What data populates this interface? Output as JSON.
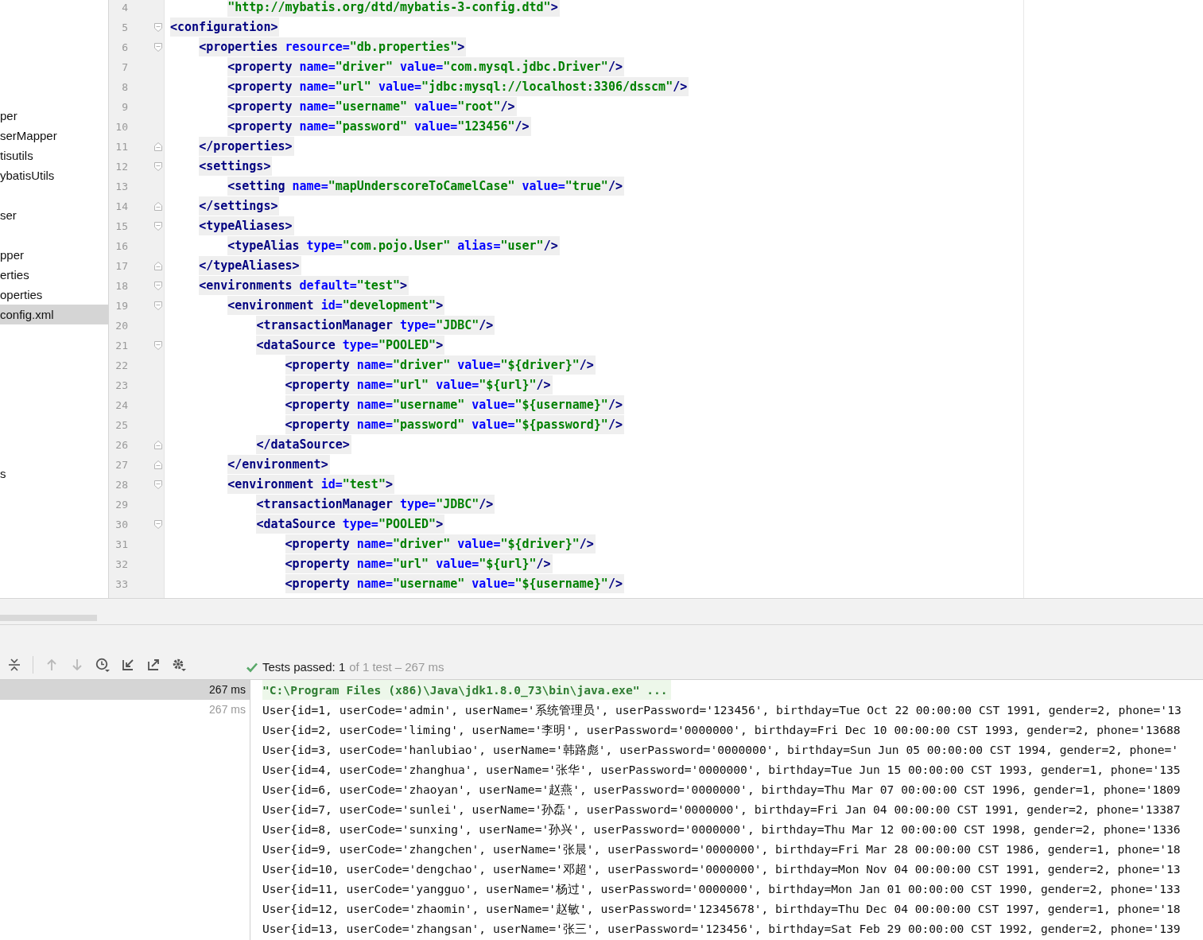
{
  "project_tree": {
    "items": [
      {
        "label": "per",
        "selected": false
      },
      {
        "label": "serMapper",
        "selected": false
      },
      {
        "label": "tisutils",
        "selected": false
      },
      {
        "label": "ybatisUtils",
        "selected": false
      },
      {
        "label": "ser",
        "selected": false
      },
      {
        "label": "pper",
        "selected": false
      },
      {
        "label": "erties",
        "selected": false
      },
      {
        "label": "operties",
        "selected": false
      },
      {
        "label": "config.xml",
        "selected": true
      },
      {
        "label": "s",
        "selected": false
      }
    ]
  },
  "editor": {
    "lines": [
      {
        "number": "4",
        "tokens": [
          {
            "kind": "value",
            "text": "        \"http://mybatis.org/dtd/mybatis-3-config.dtd\""
          },
          {
            "kind": "tag",
            "text": ">"
          }
        ]
      },
      {
        "number": "5",
        "kind": "open",
        "tokens": [
          {
            "kind": "tag",
            "text": "<configuration>"
          }
        ]
      },
      {
        "number": "6",
        "kind": "open",
        "tokens": [
          {
            "kind": "tag",
            "text": "    <properties"
          },
          {
            "kind": "attr",
            "text": " resource="
          },
          {
            "kind": "value",
            "text": "\"db.properties\""
          },
          {
            "kind": "tag",
            "text": ">"
          }
        ]
      },
      {
        "number": "7",
        "tokens": [
          {
            "kind": "tag",
            "text": "        <property"
          },
          {
            "kind": "attr",
            "text": " name="
          },
          {
            "kind": "value",
            "text": "\"driver\""
          },
          {
            "kind": "attr",
            "text": " value="
          },
          {
            "kind": "value",
            "text": "\"com.mysql.jdbc.Driver\""
          },
          {
            "kind": "tag",
            "text": "/>"
          }
        ]
      },
      {
        "number": "8",
        "tokens": [
          {
            "kind": "tag",
            "text": "        <property"
          },
          {
            "kind": "attr",
            "text": " name="
          },
          {
            "kind": "value",
            "text": "\"url\""
          },
          {
            "kind": "attr",
            "text": " value="
          },
          {
            "kind": "value",
            "text": "\"jdbc:mysql://localhost:3306/dsscm\""
          },
          {
            "kind": "tag",
            "text": "/>"
          }
        ]
      },
      {
        "number": "9",
        "tokens": [
          {
            "kind": "tag",
            "text": "        <property"
          },
          {
            "kind": "attr",
            "text": " name="
          },
          {
            "kind": "value",
            "text": "\"username\""
          },
          {
            "kind": "attr",
            "text": " value="
          },
          {
            "kind": "value",
            "text": "\"root\""
          },
          {
            "kind": "tag",
            "text": "/>"
          }
        ]
      },
      {
        "number": "10",
        "tokens": [
          {
            "kind": "tag",
            "text": "        <property"
          },
          {
            "kind": "attr",
            "text": " name="
          },
          {
            "kind": "value",
            "text": "\"password\""
          },
          {
            "kind": "attr",
            "text": " value="
          },
          {
            "kind": "value",
            "text": "\"123456\""
          },
          {
            "kind": "tag",
            "text": "/>"
          }
        ]
      },
      {
        "number": "11",
        "kind": "close",
        "tokens": [
          {
            "kind": "tag",
            "text": "    </properties>"
          }
        ]
      },
      {
        "number": "12",
        "kind": "open",
        "tokens": [
          {
            "kind": "tag",
            "text": "    <settings>"
          }
        ]
      },
      {
        "number": "13",
        "tokens": [
          {
            "kind": "tag",
            "text": "        <setting"
          },
          {
            "kind": "attr",
            "text": " name="
          },
          {
            "kind": "value",
            "text": "\"mapUnderscoreToCamelCase\""
          },
          {
            "kind": "attr",
            "text": " value="
          },
          {
            "kind": "value",
            "text": "\"true\""
          },
          {
            "kind": "tag",
            "text": "/>"
          }
        ]
      },
      {
        "number": "14",
        "kind": "close",
        "tokens": [
          {
            "kind": "tag",
            "text": "    </settings>"
          }
        ]
      },
      {
        "number": "15",
        "kind": "open",
        "tokens": [
          {
            "kind": "tag",
            "text": "    <typeAliases>"
          }
        ]
      },
      {
        "number": "16",
        "tokens": [
          {
            "kind": "tag",
            "text": "        <typeAlias"
          },
          {
            "kind": "attr",
            "text": " type="
          },
          {
            "kind": "value",
            "text": "\"com.pojo.User\""
          },
          {
            "kind": "attr",
            "text": " alias="
          },
          {
            "kind": "value",
            "text": "\"user\""
          },
          {
            "kind": "tag",
            "text": "/>"
          }
        ]
      },
      {
        "number": "17",
        "kind": "close",
        "tokens": [
          {
            "kind": "tag",
            "text": "    </typeAliases>"
          }
        ]
      },
      {
        "number": "18",
        "kind": "open",
        "tokens": [
          {
            "kind": "tag",
            "text": "    <environments"
          },
          {
            "kind": "attr",
            "text": " default="
          },
          {
            "kind": "value",
            "text": "\"test\""
          },
          {
            "kind": "tag",
            "text": ">"
          }
        ]
      },
      {
        "number": "19",
        "kind": "open",
        "tokens": [
          {
            "kind": "tag",
            "text": "        <environment"
          },
          {
            "kind": "attr",
            "text": " id="
          },
          {
            "kind": "value",
            "text": "\"development\""
          },
          {
            "kind": "tag",
            "text": ">"
          }
        ]
      },
      {
        "number": "20",
        "tokens": [
          {
            "kind": "tag",
            "text": "            <transactionManager"
          },
          {
            "kind": "attr",
            "text": " type="
          },
          {
            "kind": "value",
            "text": "\"JDBC\""
          },
          {
            "kind": "tag",
            "text": "/>"
          }
        ]
      },
      {
        "number": "21",
        "kind": "open",
        "tokens": [
          {
            "kind": "tag",
            "text": "            <dataSource"
          },
          {
            "kind": "attr",
            "text": " type="
          },
          {
            "kind": "value",
            "text": "\"POOLED\""
          },
          {
            "kind": "tag",
            "text": ">"
          }
        ]
      },
      {
        "number": "22",
        "tokens": [
          {
            "kind": "tag",
            "text": "                <property"
          },
          {
            "kind": "attr",
            "text": " name="
          },
          {
            "kind": "value",
            "text": "\"driver\""
          },
          {
            "kind": "attr",
            "text": " value="
          },
          {
            "kind": "value",
            "text": "\"${driver}\""
          },
          {
            "kind": "tag",
            "text": "/>"
          }
        ]
      },
      {
        "number": "23",
        "tokens": [
          {
            "kind": "tag",
            "text": "                <property"
          },
          {
            "kind": "attr",
            "text": " name="
          },
          {
            "kind": "value",
            "text": "\"url\""
          },
          {
            "kind": "attr",
            "text": " value="
          },
          {
            "kind": "value",
            "text": "\"${url}\""
          },
          {
            "kind": "tag",
            "text": "/>"
          }
        ]
      },
      {
        "number": "24",
        "tokens": [
          {
            "kind": "tag",
            "text": "                <property"
          },
          {
            "kind": "attr",
            "text": " name="
          },
          {
            "kind": "value",
            "text": "\"username\""
          },
          {
            "kind": "attr",
            "text": " value="
          },
          {
            "kind": "value",
            "text": "\"${username}\""
          },
          {
            "kind": "tag",
            "text": "/>"
          }
        ]
      },
      {
        "number": "25",
        "tokens": [
          {
            "kind": "tag",
            "text": "                <property"
          },
          {
            "kind": "attr",
            "text": " name="
          },
          {
            "kind": "value",
            "text": "\"password\""
          },
          {
            "kind": "attr",
            "text": " value="
          },
          {
            "kind": "value",
            "text": "\"${password}\""
          },
          {
            "kind": "tag",
            "text": "/>"
          }
        ]
      },
      {
        "number": "26",
        "kind": "close",
        "tokens": [
          {
            "kind": "tag",
            "text": "            </dataSource>"
          }
        ]
      },
      {
        "number": "27",
        "kind": "close",
        "tokens": [
          {
            "kind": "tag",
            "text": "        </environment>"
          }
        ]
      },
      {
        "number": "28",
        "kind": "open",
        "tokens": [
          {
            "kind": "tag",
            "text": "        <environment"
          },
          {
            "kind": "attr",
            "text": " id="
          },
          {
            "kind": "value",
            "text": "\"test\""
          },
          {
            "kind": "tag",
            "text": ">"
          }
        ]
      },
      {
        "number": "29",
        "tokens": [
          {
            "kind": "tag",
            "text": "            <transactionManager"
          },
          {
            "kind": "attr",
            "text": " type="
          },
          {
            "kind": "value",
            "text": "\"JDBC\""
          },
          {
            "kind": "tag",
            "text": "/>"
          }
        ]
      },
      {
        "number": "30",
        "kind": "open",
        "tokens": [
          {
            "kind": "tag",
            "text": "            <dataSource"
          },
          {
            "kind": "attr",
            "text": " type="
          },
          {
            "kind": "value",
            "text": "\"POOLED\""
          },
          {
            "kind": "tag",
            "text": ">"
          }
        ]
      },
      {
        "number": "31",
        "tokens": [
          {
            "kind": "tag",
            "text": "                <property"
          },
          {
            "kind": "attr",
            "text": " name="
          },
          {
            "kind": "value",
            "text": "\"driver\""
          },
          {
            "kind": "attr",
            "text": " value="
          },
          {
            "kind": "value",
            "text": "\"${driver}\""
          },
          {
            "kind": "tag",
            "text": "/>"
          }
        ]
      },
      {
        "number": "32",
        "tokens": [
          {
            "kind": "tag",
            "text": "                <property"
          },
          {
            "kind": "attr",
            "text": " name="
          },
          {
            "kind": "value",
            "text": "\"url\""
          },
          {
            "kind": "attr",
            "text": " value="
          },
          {
            "kind": "value",
            "text": "\"${url}\""
          },
          {
            "kind": "tag",
            "text": "/>"
          }
        ]
      },
      {
        "number": "33",
        "tokens": [
          {
            "kind": "tag",
            "text": "                <property"
          },
          {
            "kind": "attr",
            "text": " name="
          },
          {
            "kind": "value",
            "text": "\"username\""
          },
          {
            "kind": "attr",
            "text": " value="
          },
          {
            "kind": "value",
            "text": "\"${username}\""
          },
          {
            "kind": "tag",
            "text": "/>"
          }
        ]
      }
    ]
  },
  "run_panel": {
    "toolbar": [
      {
        "kind": "collapse",
        "disabled": false
      },
      {
        "kind": "up",
        "disabled": true
      },
      {
        "kind": "down",
        "disabled": true
      },
      {
        "kind": "history",
        "disabled": false
      },
      {
        "kind": "import",
        "disabled": false
      },
      {
        "kind": "export",
        "disabled": false
      },
      {
        "kind": "settings",
        "disabled": false
      }
    ],
    "status": {
      "passed": true,
      "summary": "Tests passed: 1",
      "detail": "of 1 test – 267 ms"
    },
    "test_tree": [
      {
        "time": "267 ms",
        "selected": true
      },
      {
        "time": "267 ms",
        "selected": false
      }
    ],
    "console": [
      {
        "kind": "command",
        "text": "\"C:\\Program Files (x86)\\Java\\jdk1.8.0_73\\bin\\java.exe\" ..."
      },
      {
        "kind": "output",
        "text": "User{id=1, userCode='admin', userName='系统管理员', userPassword='123456', birthday=Tue Oct 22 00:00:00 CST 1991, gender=2, phone='13"
      },
      {
        "kind": "output",
        "text": "User{id=2, userCode='liming', userName='李明', userPassword='0000000', birthday=Fri Dec 10 00:00:00 CST 1993, gender=2, phone='13688"
      },
      {
        "kind": "output",
        "text": "User{id=3, userCode='hanlubiao', userName='韩路彪', userPassword='0000000', birthday=Sun Jun 05 00:00:00 CST 1994, gender=2, phone='"
      },
      {
        "kind": "output",
        "text": "User{id=4, userCode='zhanghua', userName='张华', userPassword='0000000', birthday=Tue Jun 15 00:00:00 CST 1993, gender=1, phone='135"
      },
      {
        "kind": "output",
        "text": "User{id=6, userCode='zhaoyan', userName='赵燕', userPassword='0000000', birthday=Thu Mar 07 00:00:00 CST 1996, gender=1, phone='1809"
      },
      {
        "kind": "output",
        "text": "User{id=7, userCode='sunlei', userName='孙磊', userPassword='0000000', birthday=Fri Jan 04 00:00:00 CST 1991, gender=2, phone='13387"
      },
      {
        "kind": "output",
        "text": "User{id=8, userCode='sunxing', userName='孙兴', userPassword='0000000', birthday=Thu Mar 12 00:00:00 CST 1998, gender=2, phone='1336"
      },
      {
        "kind": "output",
        "text": "User{id=9, userCode='zhangchen', userName='张晨', userPassword='0000000', birthday=Fri Mar 28 00:00:00 CST 1986, gender=1, phone='18"
      },
      {
        "kind": "output",
        "text": "User{id=10, userCode='dengchao', userName='邓超', userPassword='0000000', birthday=Mon Nov 04 00:00:00 CST 1991, gender=2, phone='13"
      },
      {
        "kind": "output",
        "text": "User{id=11, userCode='yangguo', userName='杨过', userPassword='0000000', birthday=Mon Jan 01 00:00:00 CST 1990, gender=2, phone='133"
      },
      {
        "kind": "output",
        "text": "User{id=12, userCode='zhaomin', userName='赵敏', userPassword='12345678', birthday=Thu Dec 04 00:00:00 CST 1997, gender=1, phone='18"
      },
      {
        "kind": "output",
        "text": "User{id=13, userCode='zhangsan', userName='张三', userPassword='123456', birthday=Sat Feb 29 00:00:00 CST 1992, gender=2, phone='139"
      }
    ]
  }
}
